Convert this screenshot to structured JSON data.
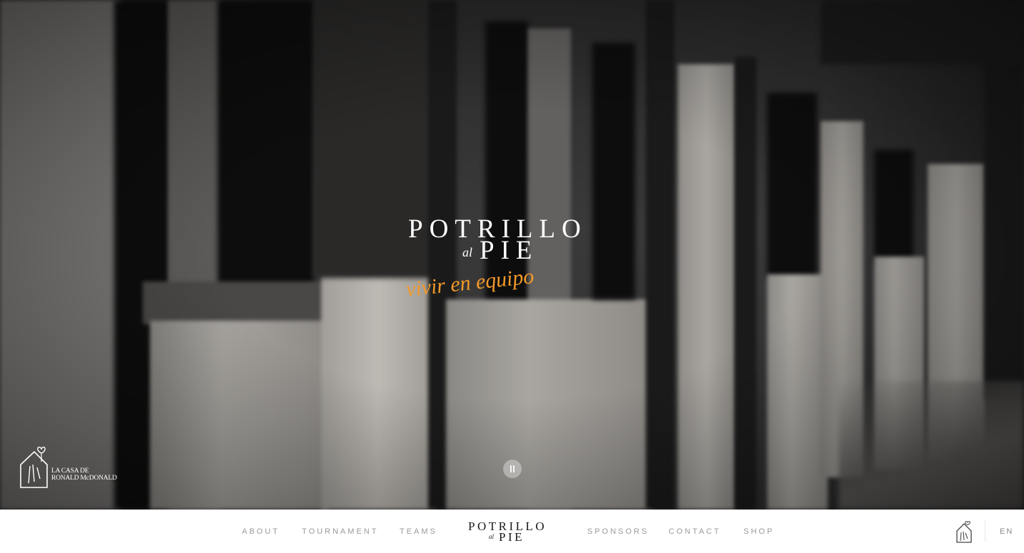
{
  "hero": {
    "brand_line1": "POTRILLO",
    "brand_al": "al",
    "brand_line2": "PIE",
    "tagline": "vivir en equipo",
    "partner_line1": "LA CASA DE",
    "partner_line2": "RONALD McDONALD",
    "video_control": "pause-icon"
  },
  "nav": {
    "left_items": [
      "ABOUT",
      "TOURNAMENT",
      "TEAMS"
    ],
    "right_items": [
      "SPONSORS",
      "CONTACT",
      "SHOP"
    ],
    "logo_line1": "POTRILLO",
    "logo_al": "al",
    "logo_line2": "PIE",
    "language": "EN"
  },
  "colors": {
    "accent_orange": "#f39a2a",
    "nav_text": "#9a9a9a",
    "logo_dark": "#1a1a1a"
  }
}
